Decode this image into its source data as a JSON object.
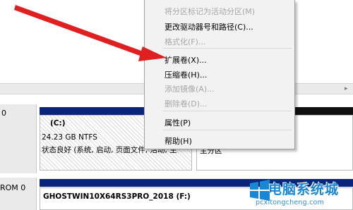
{
  "context_menu": {
    "items": [
      {
        "label": "将分区标记为活动分区(M)",
        "enabled": false
      },
      {
        "label": "更改驱动器号和路径(C)...",
        "enabled": true
      },
      {
        "label": "格式化(F)...",
        "enabled": false
      },
      {
        "label": "扩展卷(X)...",
        "enabled": true
      },
      {
        "label": "压缩卷(H)...",
        "enabled": true
      },
      {
        "label": "添加镜像(A)...",
        "enabled": false
      },
      {
        "label": "删除卷(D)...",
        "enabled": false
      },
      {
        "label": "属性(P)",
        "enabled": true
      },
      {
        "label": "帮助(H)",
        "enabled": true
      }
    ]
  },
  "disks": [
    {
      "label": "0"
    },
    {
      "label": "ROM 0"
    }
  ],
  "volume_c": {
    "name": "(C:)",
    "size": "24.23 GB NTFS",
    "status": "状态良好 (系统, 启动, 页面文件, 活动, 主"
  },
  "volume_right": {
    "status": "主分区"
  },
  "volume_dvd": {
    "name": "GHOSTWIN10X64RS3PRO_2018  (F:)"
  },
  "watermark": {
    "title": "电脑系统城",
    "url": "pcxitongcheng.com"
  },
  "colors": {
    "primary_bar": "#0a247a",
    "menu_background": "#f2f2f2",
    "arrow": "#e02020",
    "disabled_text": "#a6a6a6"
  }
}
